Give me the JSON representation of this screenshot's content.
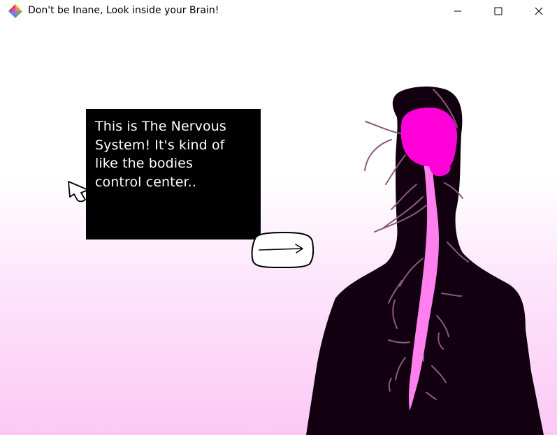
{
  "window": {
    "title": "Don't be Inane, Look inside your Brain!",
    "app_icon": "app-logo-icon",
    "controls": {
      "minimize_icon": "minimize-icon",
      "maximize_icon": "maximize-icon",
      "close_icon": "close-icon"
    }
  },
  "dialog": {
    "text": "This is The Nervous\nSystem! It's kind of\nlike the bodies\ncontrol center.."
  },
  "next_button": {
    "icon": "arrow-right-icon"
  },
  "colors": {
    "brain": "#ff00d9",
    "spinal_cord": "#ff80ee",
    "body_silhouette": "#120011",
    "nerves": "#8c5a7d",
    "background_bottom": "#fbc8f5"
  }
}
